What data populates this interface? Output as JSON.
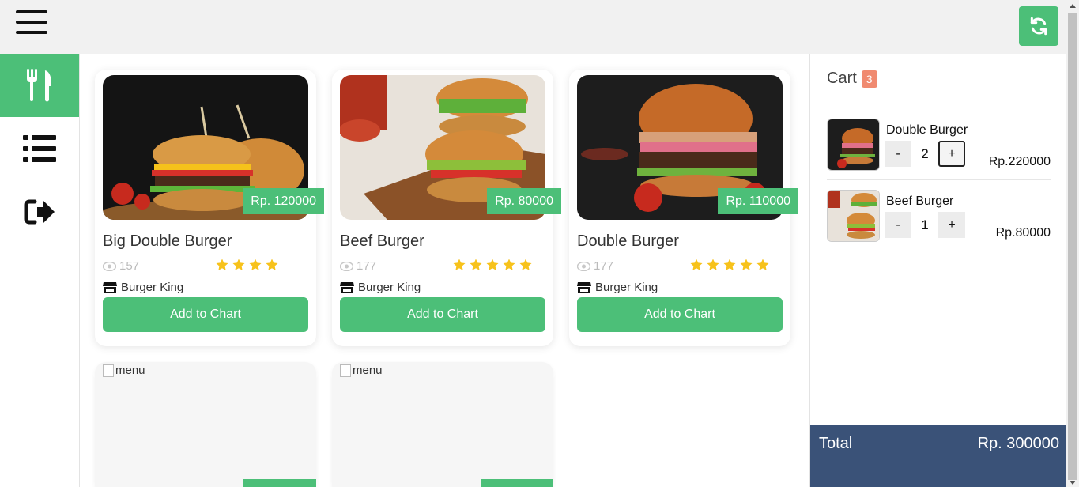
{
  "header": {
    "menu_icon": "hamburger-icon",
    "refresh_icon": "refresh-icon",
    "accent_color": "#4cbf78"
  },
  "sidebar": {
    "items": [
      {
        "icon": "utensils-icon",
        "active": true
      },
      {
        "icon": "list-icon",
        "active": false
      },
      {
        "icon": "sign-out-icon",
        "active": false
      }
    ]
  },
  "menu": {
    "items": [
      {
        "name": "Big Double Burger",
        "price": "Rp. 120000",
        "views": "157",
        "rating": 4,
        "store": "Burger King",
        "button": "Add to Chart"
      },
      {
        "name": "Beef Burger",
        "price": "Rp. 80000",
        "views": "177",
        "rating": 5,
        "store": "Burger King",
        "button": "Add to Chart"
      },
      {
        "name": "Double Burger",
        "price": "Rp. 110000",
        "views": "177",
        "rating": 5,
        "store": "Burger King",
        "button": "Add to Chart"
      }
    ],
    "broken_images": [
      {
        "alt": "menu"
      },
      {
        "alt": "menu"
      }
    ]
  },
  "cart": {
    "title": "Cart",
    "count": "3",
    "items": [
      {
        "name": "Double Burger",
        "qty": "2",
        "price": "Rp.220000",
        "minus": "-",
        "plus": "+"
      },
      {
        "name": "Beef Burger",
        "qty": "1",
        "price": "Rp.80000",
        "minus": "-",
        "plus": "+"
      }
    ],
    "total_label": "Total",
    "total_value": "Rp. 300000",
    "badge_color": "#f08a70",
    "total_bar_color": "#3a5278"
  }
}
